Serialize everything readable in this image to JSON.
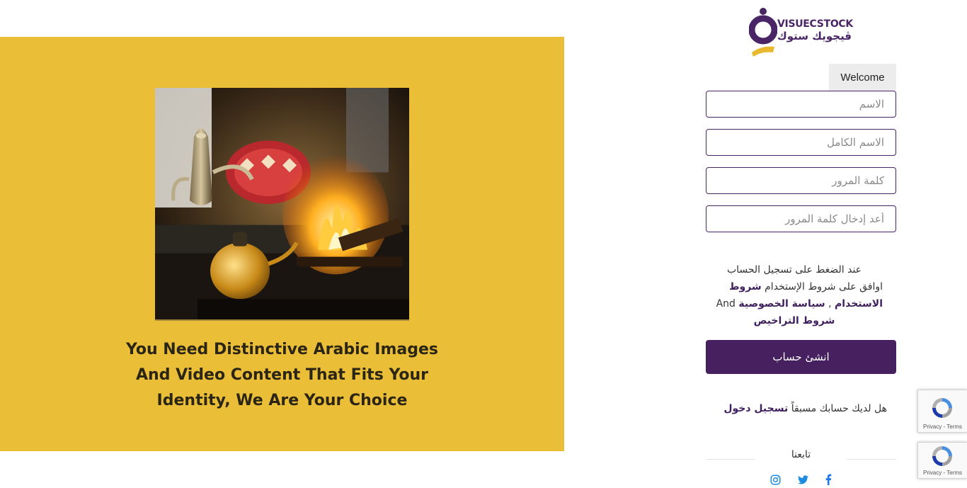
{
  "logo": {
    "name_en": "VISUECSTOCK",
    "name_ar": "ڤيجويك ستوك"
  },
  "hero": {
    "caption": "You Need Distinctive Arabic Images And Video Content That Fits Your Identity, We Are Your Choice"
  },
  "form": {
    "tab_label": "Welcome",
    "username_placeholder": "الاسم",
    "fullname_placeholder": "الاسم الكامل",
    "password_placeholder": "كلمة المرور",
    "password_confirm_placeholder": "أعد إدخال كلمة المرور",
    "terms_line1": "عند الضغط على تسجيل الحساب",
    "terms_line2": "اوافق على شروط الإستخدام",
    "terms_link": "شروط الاستخدام",
    "terms_sep": " , ",
    "privacy_link": "سياسة الخصوصية",
    "and_word": "And",
    "licenses_link": "شروط التراخيص",
    "submit_label": "انشئ حساب",
    "have_account": "هل لديك حسابك مسبقاً",
    "login_link": "تسجيل دخول",
    "follow_label": "تابعنا"
  },
  "social": [
    {
      "icon": "facebook-icon"
    },
    {
      "icon": "twitter-icon"
    },
    {
      "icon": "instagram-icon"
    }
  ],
  "recaptcha": {
    "links": "Privacy - Terms"
  },
  "colors": {
    "brand_purple": "#46205f",
    "hero_yellow": "#ebbe37",
    "social_blue": "#1877f2"
  }
}
